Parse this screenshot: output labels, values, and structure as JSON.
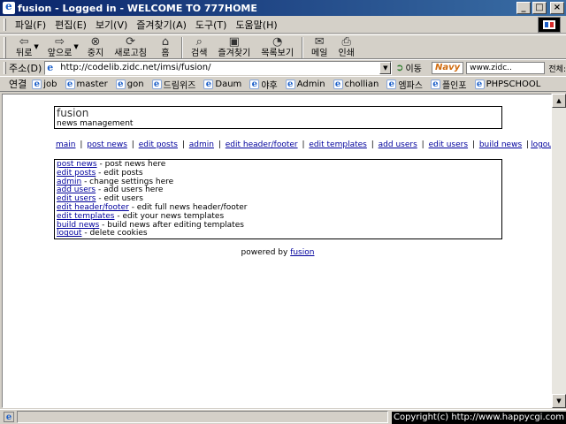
{
  "window": {
    "title": "fusion - Logged in - WELCOME TO 777HOME",
    "buttons": {
      "minimize": "_",
      "maximize": "□",
      "close": "×"
    }
  },
  "menubar": [
    "파일(F)",
    "편집(E)",
    "보기(V)",
    "즐겨찾기(A)",
    "도구(T)",
    "도움말(H)"
  ],
  "toolbar": {
    "back": "뒤로",
    "forward": "앞으로",
    "stop": "중지",
    "refresh": "새로고침",
    "home": "홈",
    "search": "검색",
    "favorites": "즐겨찾기",
    "history": "목록보기",
    "mail": "메일",
    "print": "인쇄"
  },
  "address": {
    "label": "주소(D)",
    "url": "http://codelib.zidc.net/imsi/fusion/",
    "go": "이동",
    "navy_logo": "Navy",
    "navy_input": "www.zidc..",
    "navy_all": "전체:"
  },
  "links": {
    "lead": "연결",
    "items": [
      "job",
      "master",
      "gon",
      "드림위즈",
      "Daum",
      "야후",
      "Admin",
      "chollian",
      "엠파스",
      "플인포",
      "PHPSCHOOL"
    ]
  },
  "page": {
    "site_title": "fusion",
    "site_subtitle": "news management",
    "nav": [
      "main",
      "post news",
      "edit posts",
      "admin",
      "edit header/footer",
      "edit templates",
      "add users",
      "edit users",
      "build news",
      "logout"
    ],
    "nav_sep": "|",
    "menu": [
      {
        "link": "post news",
        "desc": " - post news here"
      },
      {
        "link": "edit posts",
        "desc": " - edit posts"
      },
      {
        "link": "admin",
        "desc": " - change settings here"
      },
      {
        "link": "add users",
        "desc": " - add users here"
      },
      {
        "link": "edit users",
        "desc": " - edit users"
      },
      {
        "link": "edit header/footer",
        "desc": " - edit full news header/footer"
      },
      {
        "link": "edit templates",
        "desc": " - edit your news templates"
      },
      {
        "link": "build news",
        "desc": " - build news after editing templates"
      },
      {
        "link": "logout",
        "desc": " - delete cookies"
      }
    ],
    "powered_text": "powered by",
    "powered_link": "fusion"
  },
  "status": {
    "copyright": "Copyright(c) http://www.happycgi.com"
  }
}
